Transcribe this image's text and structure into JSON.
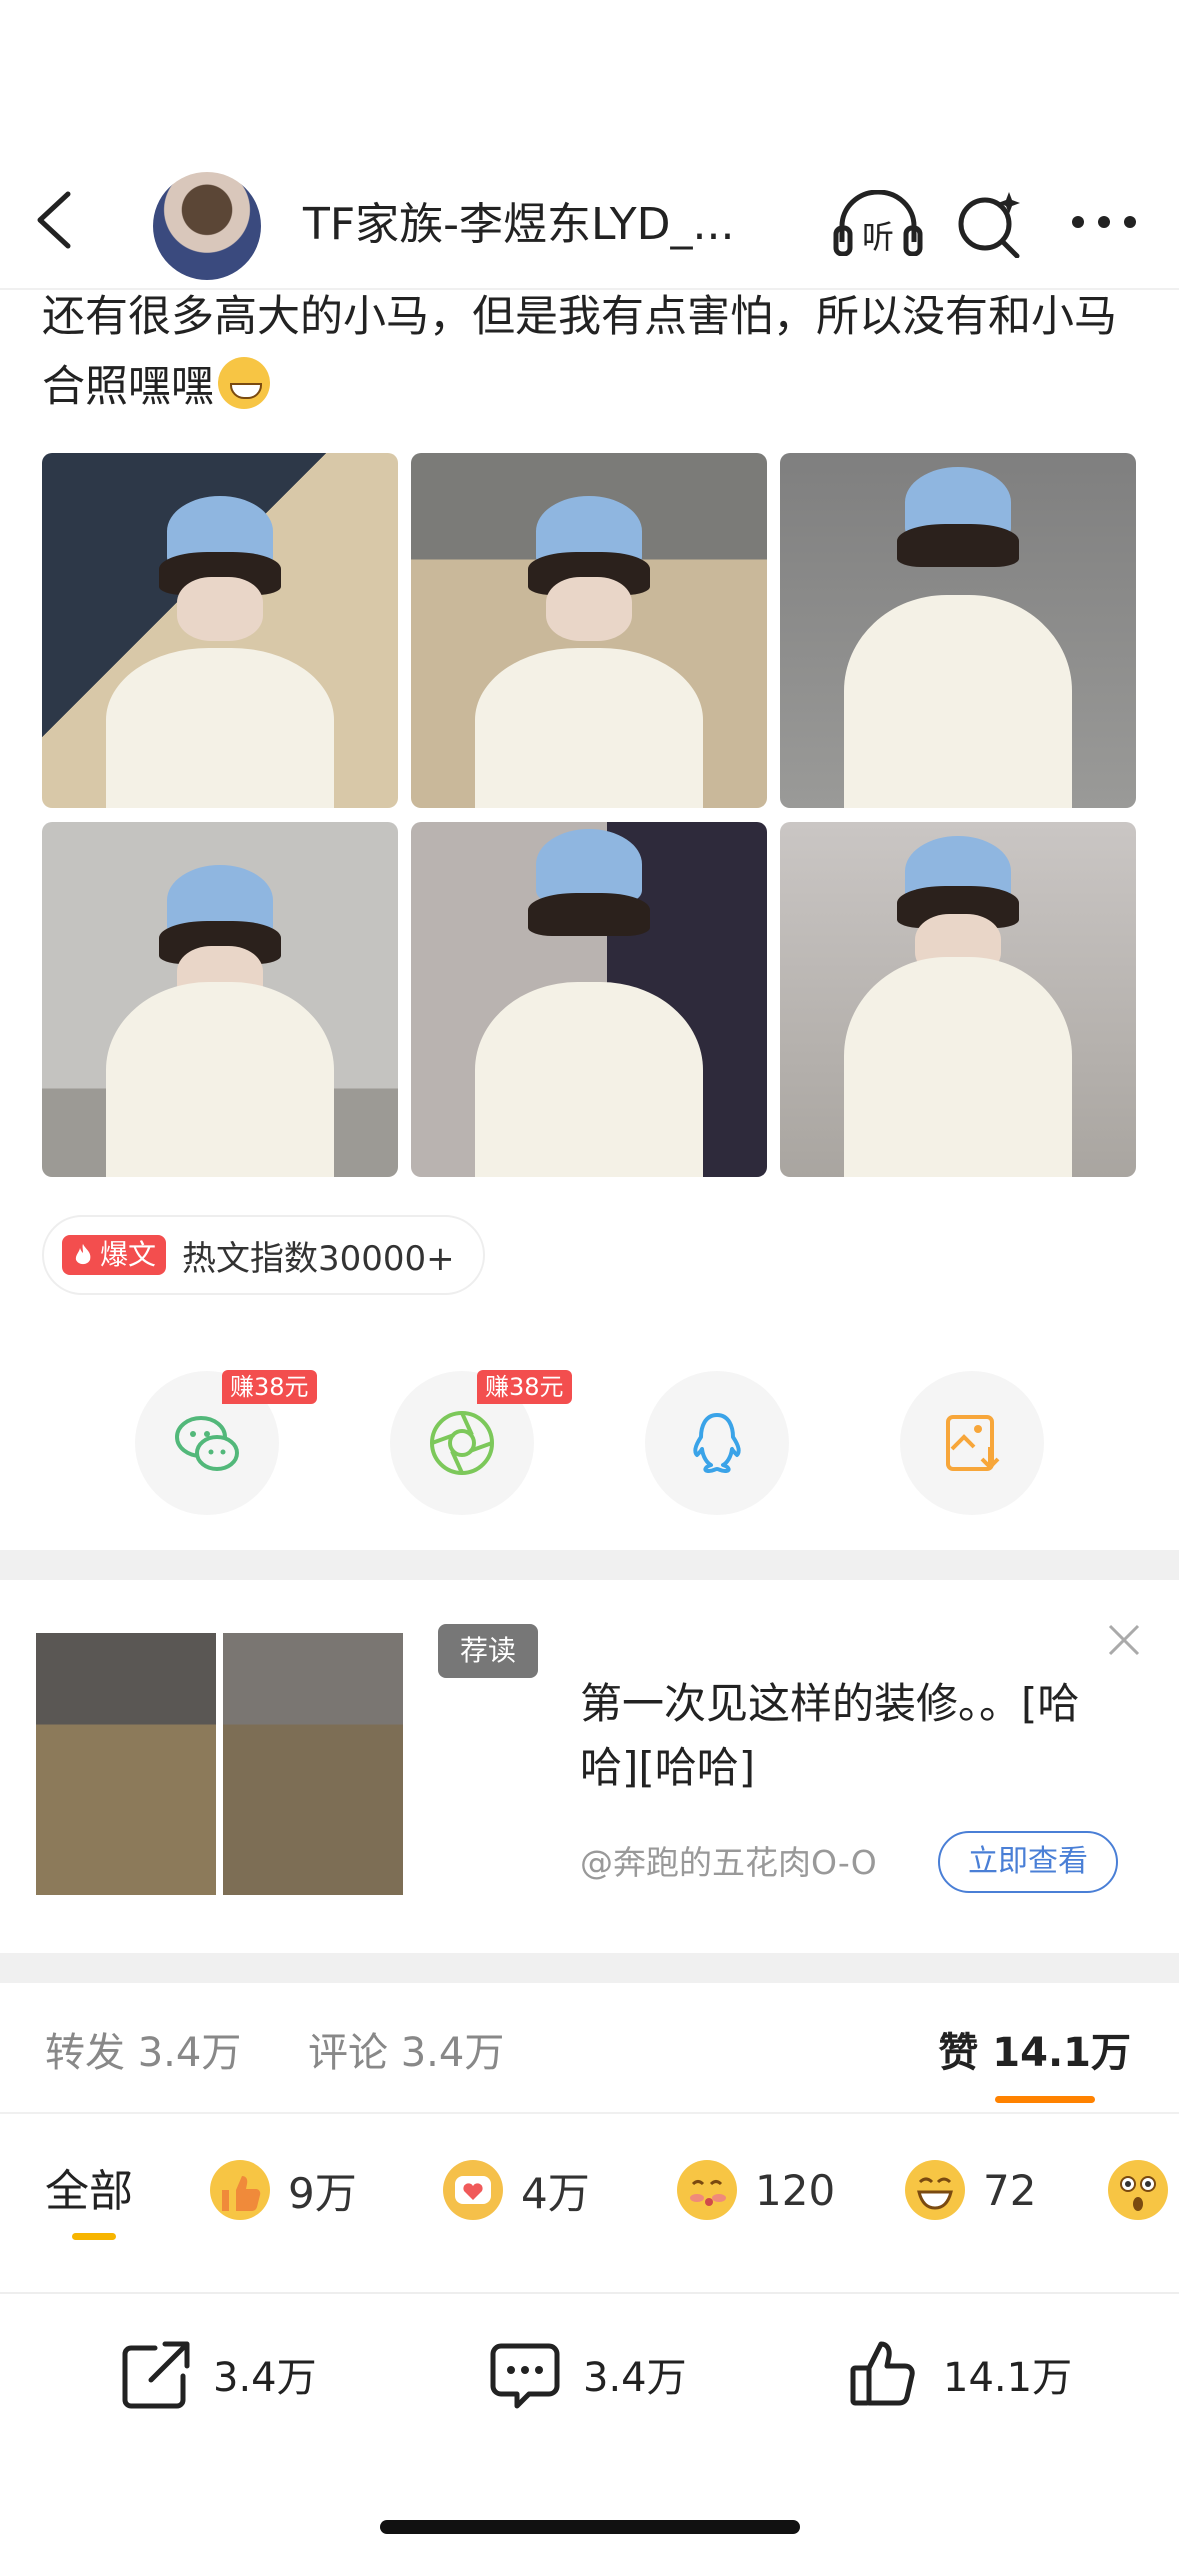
{
  "header": {
    "title": "TF家族-李煜东LYD_...",
    "listen_label": "听"
  },
  "post": {
    "text": "还有很多高大的小马，但是我有点害怕，所以没有和小马合照嘿嘿",
    "emoji": "grinning-face"
  },
  "hot_badge": {
    "tag": "爆文",
    "text": "热文指数30000+"
  },
  "share": {
    "wechat_badge": "赚38元",
    "moments_badge": "赚38元"
  },
  "ad": {
    "tag": "荐读",
    "title": "第一次见这样的装修。。[哈哈][哈哈]",
    "author": "@奔跑的五花肉O-O",
    "button": "立即查看"
  },
  "stats": {
    "repost_label": "转发",
    "repost_count": "3.4万",
    "comment_label": "评论",
    "comment_count": "3.4万",
    "like_label": "赞",
    "like_count": "14.1万"
  },
  "reactions": {
    "all": "全部",
    "items": [
      {
        "icon": "thumbs-up-emoji",
        "count": "9万"
      },
      {
        "icon": "heart-face-emoji",
        "count": "4万"
      },
      {
        "icon": "kiss-face-emoji",
        "count": "120"
      },
      {
        "icon": "laugh-emoji",
        "count": "72"
      },
      {
        "icon": "surprised-emoji",
        "count": ""
      }
    ]
  },
  "bottom_bar": {
    "repost": "3.4万",
    "comment": "3.4万",
    "like": "14.1万"
  }
}
